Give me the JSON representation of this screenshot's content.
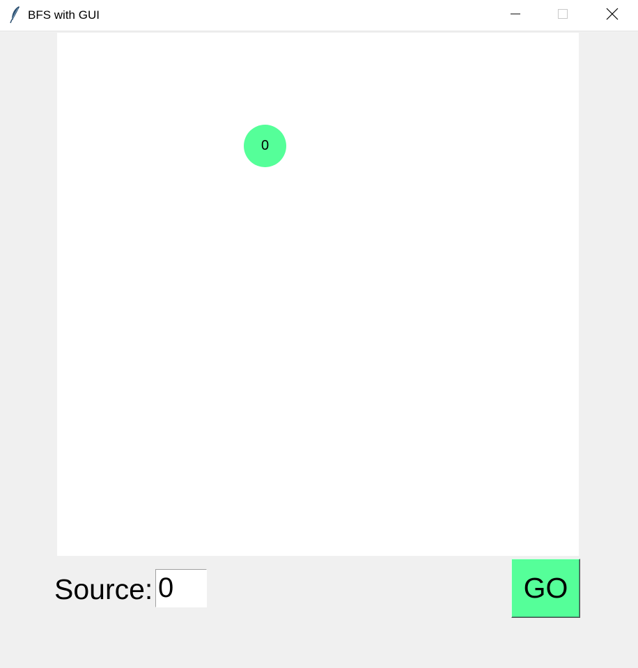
{
  "window": {
    "title": "BFS with GUI",
    "app_icon": "feather-icon",
    "controls": {
      "minimize_icon": "minimize-icon",
      "maximize_icon": "maximize-icon",
      "close_icon": "close-icon"
    }
  },
  "graph": {
    "nodes": [
      {
        "label": "0",
        "color": "#55ff99"
      }
    ]
  },
  "controls": {
    "source_label": "Source:",
    "source_value": "0",
    "go_label": "GO",
    "go_color": "#55ff99"
  },
  "colors": {
    "window_bg": "#f0f0f0",
    "canvas_bg": "#ffffff",
    "accent": "#55ff99"
  }
}
